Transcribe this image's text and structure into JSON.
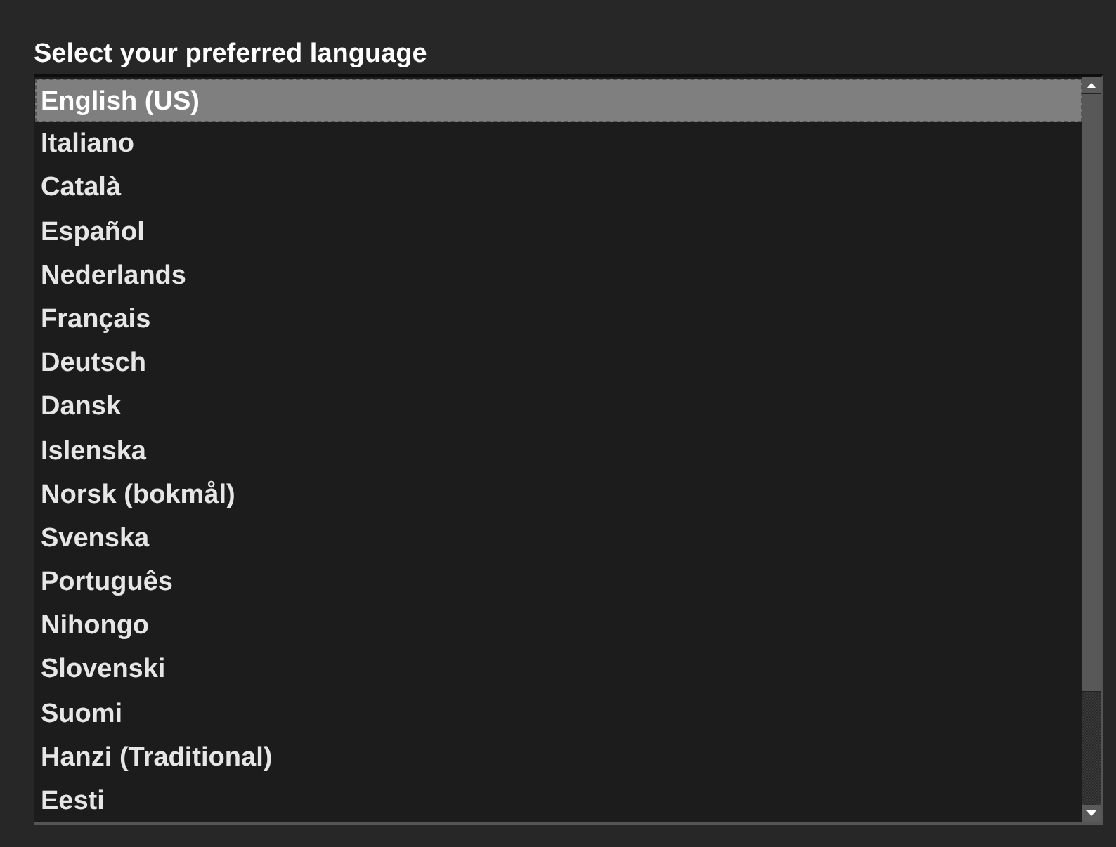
{
  "title": "Select your preferred language",
  "languages": [
    {
      "label": "English (US)",
      "selected": true
    },
    {
      "label": "Italiano",
      "selected": false
    },
    {
      "label": "Català",
      "selected": false
    },
    {
      "label": "Español",
      "selected": false
    },
    {
      "label": "Nederlands",
      "selected": false
    },
    {
      "label": "Français",
      "selected": false
    },
    {
      "label": "Deutsch",
      "selected": false
    },
    {
      "label": "Dansk",
      "selected": false
    },
    {
      "label": "Islenska",
      "selected": false
    },
    {
      "label": "Norsk (bokmål)",
      "selected": false
    },
    {
      "label": "Svenska",
      "selected": false
    },
    {
      "label": "Português",
      "selected": false
    },
    {
      "label": "Nihongo",
      "selected": false
    },
    {
      "label": "Slovenski",
      "selected": false
    },
    {
      "label": "Suomi",
      "selected": false
    },
    {
      "label": "Hanzi (Traditional)",
      "selected": false
    },
    {
      "label": "Eesti",
      "selected": false
    }
  ]
}
